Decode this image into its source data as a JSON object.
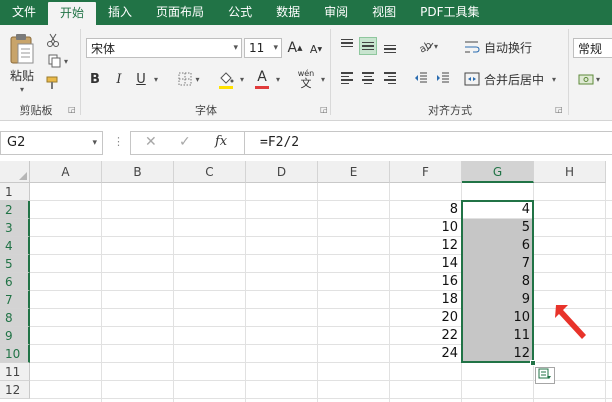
{
  "tabs": [
    {
      "label": "文件",
      "kind": "file"
    },
    {
      "label": "开始",
      "kind": "active"
    },
    {
      "label": "插入",
      "kind": ""
    },
    {
      "label": "页面布局",
      "kind": ""
    },
    {
      "label": "公式",
      "kind": ""
    },
    {
      "label": "数据",
      "kind": ""
    },
    {
      "label": "审阅",
      "kind": ""
    },
    {
      "label": "视图",
      "kind": ""
    },
    {
      "label": "PDF工具集",
      "kind": ""
    }
  ],
  "ribbon": {
    "paste_label": "粘贴",
    "clipboard_label": "剪贴板",
    "font_name": "宋体",
    "font_size": "11",
    "grow_font": "A",
    "shrink_font": "A",
    "bold": "B",
    "italic": "I",
    "underline": "U",
    "font_color_glyph": "A",
    "phonetic_glyph": "wén",
    "font_group_label": "字体",
    "wrap_text": "自动换行",
    "merge_center": "合并后居中",
    "alignment_label": "对齐方式",
    "number_format": "常规"
  },
  "formula_bar": {
    "name_box": "G2",
    "fx": "fx",
    "formula": "=F2/2"
  },
  "sheet": {
    "columns": [
      "A",
      "B",
      "C",
      "D",
      "E",
      "F",
      "G",
      "H"
    ],
    "rows": [
      "1",
      "2",
      "3",
      "4",
      "5",
      "6",
      "7",
      "8",
      "9",
      "10",
      "11",
      "12"
    ],
    "selected_column": "G",
    "selected_rows": [
      "2",
      "3",
      "4",
      "5",
      "6",
      "7",
      "8",
      "9",
      "10"
    ],
    "f_values": [
      "8",
      "10",
      "12",
      "14",
      "16",
      "18",
      "20",
      "22",
      "24"
    ],
    "g_values": [
      "4",
      "5",
      "6",
      "7",
      "8",
      "9",
      "10",
      "11",
      "12"
    ]
  },
  "colors": {
    "accent": "#217346",
    "selection_fill": "#c6c6c6",
    "arrow": "#e8332a"
  }
}
